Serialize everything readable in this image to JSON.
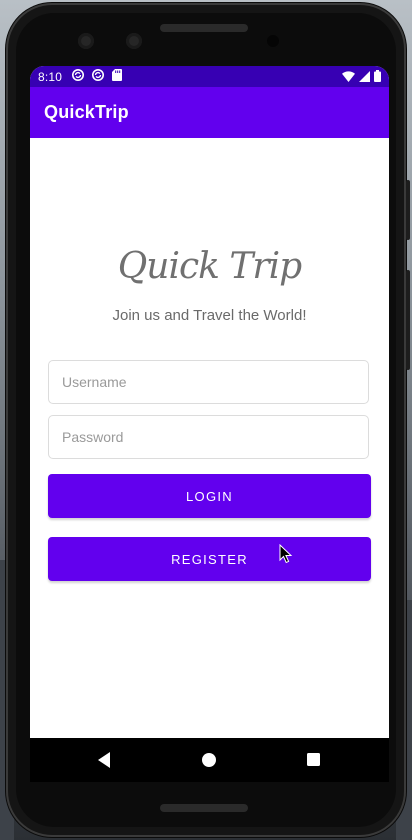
{
  "status_bar": {
    "time": "8:10",
    "left_icons": [
      "sync-icon",
      "sync-icon",
      "sd-card-icon"
    ],
    "right_icons": [
      "wifi-icon",
      "signal-icon",
      "battery-icon"
    ]
  },
  "app_bar": {
    "title": "QuickTrip"
  },
  "main": {
    "logo_text": "Quick Trip",
    "tagline": "Join us and Travel the World!",
    "username": {
      "placeholder": "Username",
      "value": ""
    },
    "password": {
      "placeholder": "Password",
      "value": ""
    },
    "login_label": "LOGIN",
    "register_label": "REGISTER"
  },
  "nav_bar": {
    "items": [
      "back-icon",
      "home-icon",
      "recents-icon"
    ]
  },
  "colors": {
    "primary": "#6200ee",
    "primary_dark": "#3700b3",
    "text_secondary": "#6a6a6a",
    "hint": "#9a9a9a"
  }
}
